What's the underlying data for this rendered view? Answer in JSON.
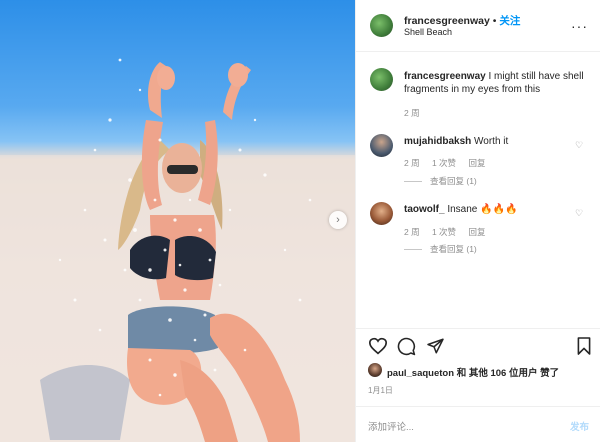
{
  "header": {
    "username": "francesgreenway",
    "dot": "•",
    "follow_label": "关注",
    "location": "Shell Beach"
  },
  "caption": {
    "username": "francesgreenway",
    "text": "I might still have shell fragments in my eyes from this",
    "time": "2 周"
  },
  "comments": [
    {
      "username": "mujahidbaksh",
      "text": "Worth it",
      "time": "2 周",
      "likes": "1 次赞",
      "reply": "回复",
      "view_replies": "查看回复 (1)"
    },
    {
      "username": "taowolf_",
      "text": "Insane 🔥🔥🔥",
      "time": "2 周",
      "likes": "1 次赞",
      "reply": "回复",
      "view_replies": "查看回复 (1)"
    }
  ],
  "likes": {
    "username": "paul_saqueton",
    "text": "和 其他 106 位用户 赞了"
  },
  "date": "1月1日",
  "add_comment": {
    "placeholder": "添加评论...",
    "post_label": "发布"
  },
  "icons": {
    "more": "more-icon",
    "next": "chevron-right-icon",
    "heart": "heart-icon",
    "comment": "comment-icon",
    "share": "share-icon",
    "save": "bookmark-icon"
  },
  "colors": {
    "accent": "#0095f6",
    "muted": "#8e8e8e",
    "text": "#262626"
  }
}
